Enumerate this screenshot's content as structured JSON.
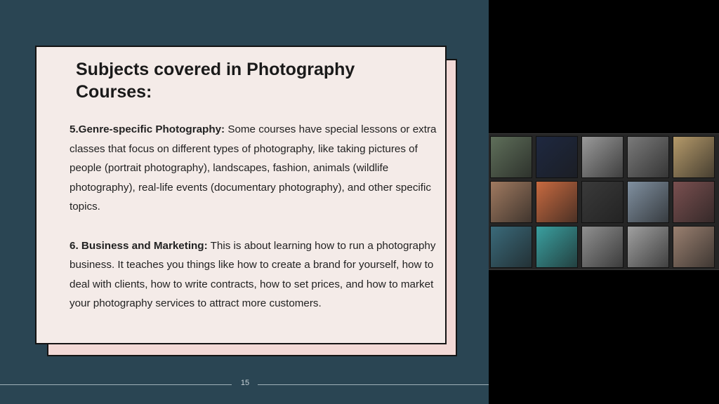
{
  "slide": {
    "title": "Subjects covered in Photography Courses:",
    "page_number": "15",
    "background_color": "#2a4553",
    "card_color": "#f4ebe8",
    "card_shadow_color": "#f2d9d6"
  },
  "sections": [
    {
      "heading": "5.Genre-specific Photography:",
      "text": " Some courses have special lessons or extra classes that focus on different types of photography, like taking pictures of people (portrait photography), landscapes, fashion, animals (wildlife photography), real-life events (documentary photography), and other specific topics."
    },
    {
      "heading": "6. Business and Marketing:",
      "text": " This is about learning how to run a photography business. It teaches you things like how to create a brand for yourself, how to deal with clients, how to write contracts, how to set prices, and how to market your photography services to attract more customers."
    }
  ],
  "photo_grid": {
    "rows": 3,
    "cols": 5,
    "thumbnails": [
      {
        "subject": "plant-leaves-photo",
        "color": "#5f6f5a"
      },
      {
        "subject": "night-street-photo",
        "color": "#1e2840"
      },
      {
        "subject": "street-people-photo",
        "color": "#9a9a9a"
      },
      {
        "subject": "woman-portrait-photo",
        "color": "#7a7a7a"
      },
      {
        "subject": "wood-texture-photo",
        "color": "#b59a6a"
      },
      {
        "subject": "old-man-portrait-photo",
        "color": "#a07a60"
      },
      {
        "subject": "child-toys-photo",
        "color": "#c86a40"
      },
      {
        "subject": "tunnel-arch-photo",
        "color": "#3a3a3a"
      },
      {
        "subject": "train-photo",
        "color": "#8090a0"
      },
      {
        "subject": "bottles-still-life-photo",
        "color": "#7a5050"
      },
      {
        "subject": "forest-pond-photo",
        "color": "#3a6a7a"
      },
      {
        "subject": "couple-photo",
        "color": "#3aa0a0"
      },
      {
        "subject": "arches-building-photo",
        "color": "#909090"
      },
      {
        "subject": "shop-shelves-photo",
        "color": "#a0a0a0"
      },
      {
        "subject": "city-street-photo",
        "color": "#9a8070"
      }
    ]
  }
}
